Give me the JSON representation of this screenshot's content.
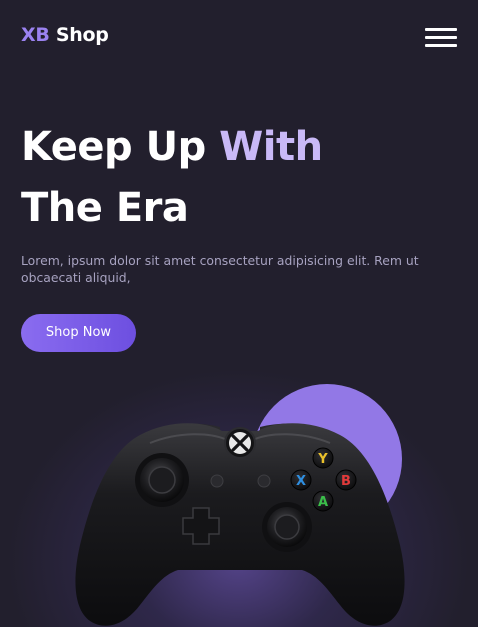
{
  "header": {
    "logo_prefix": "XB",
    "logo_suffix": " Shop",
    "menu_icon": "hamburger-menu-icon"
  },
  "hero": {
    "title_line1_part1": "Keep Up ",
    "title_line1_part2": "With",
    "title_line2": "The Era",
    "description": "Lorem, ipsum dolor sit amet consectetur adipisicing elit. Rem ut obcaecati aliquid,",
    "cta_label": "Shop Now"
  },
  "product": {
    "image": "game-controller",
    "buttons": [
      "Y",
      "X",
      "B",
      "A"
    ]
  },
  "colors": {
    "background": "#221f2d",
    "accent": "#9b82f0",
    "title_accent": "#c9b9f7",
    "circle": "#9278e6",
    "cta_start": "#8a6cf0",
    "cta_end": "#6d4fe0"
  }
}
